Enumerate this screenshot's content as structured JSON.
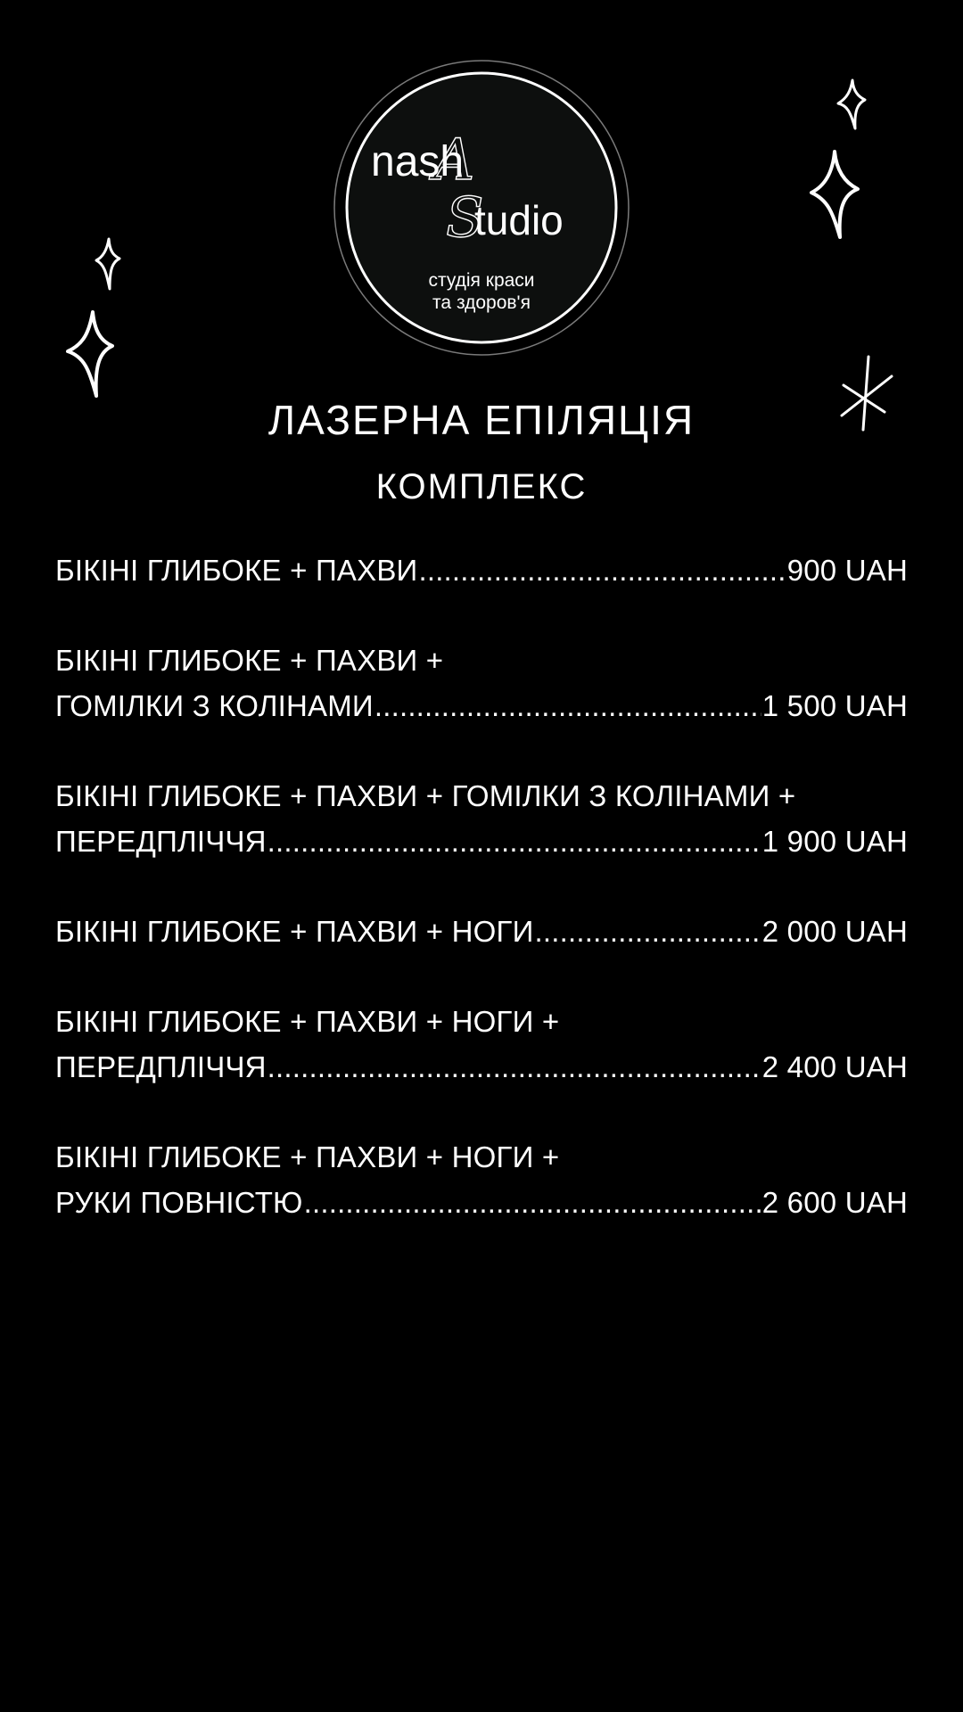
{
  "logo": {
    "brand_part1": "nash",
    "brand_script_letter": "A",
    "brand_script_letter2": "S",
    "brand_part2": "tudio",
    "tagline_line1": "студія краси",
    "tagline_line2": "та здоров'я"
  },
  "decor": {
    "icons": [
      "sparkle-icon",
      "sparkle-icon",
      "sparkle-icon",
      "sparkle-icon",
      "asterisk-icon"
    ]
  },
  "header": {
    "title": "ЛАЗЕРНА ЕПІЛЯЦІЯ",
    "subtitle": "КОМПЛЕКС"
  },
  "items": [
    {
      "first_line": "",
      "last_line": "БІКІНІ ГЛИБОКЕ + ПАХВИ",
      "price": "900 UAH"
    },
    {
      "first_line": "БІКІНІ ГЛИБОКЕ + ПАХВИ +",
      "last_line": "ГОМІЛКИ  З КОЛІНАМИ",
      "price": "1 500 UAH"
    },
    {
      "first_line": "БІКІНІ ГЛИБОКЕ + ПАХВИ + ГОМІЛКИ З КОЛІНАМИ +",
      "last_line": "ПЕРЕДПЛІЧЧЯ",
      "price": "1 900 UAH"
    },
    {
      "first_line": "",
      "last_line": "БІКІНІ ГЛИБОКЕ + ПАХВИ + НОГИ",
      "price": "2 000 UAH"
    },
    {
      "first_line": "БІКІНІ ГЛИБОКЕ + ПАХВИ + НОГИ +",
      "last_line": "ПЕРЕДПЛІЧЧЯ",
      "price": "2 400 UAH"
    },
    {
      "first_line": "БІКІНІ ГЛИБОКЕ + ПАХВИ + НОГИ +",
      "last_line": "РУКИ ПОВНІСТЮ",
      "price": "2 600 UAH"
    }
  ],
  "colors": {
    "background": "#000000",
    "text": "#ffffff",
    "logo_fill": "#0d0f0e"
  }
}
